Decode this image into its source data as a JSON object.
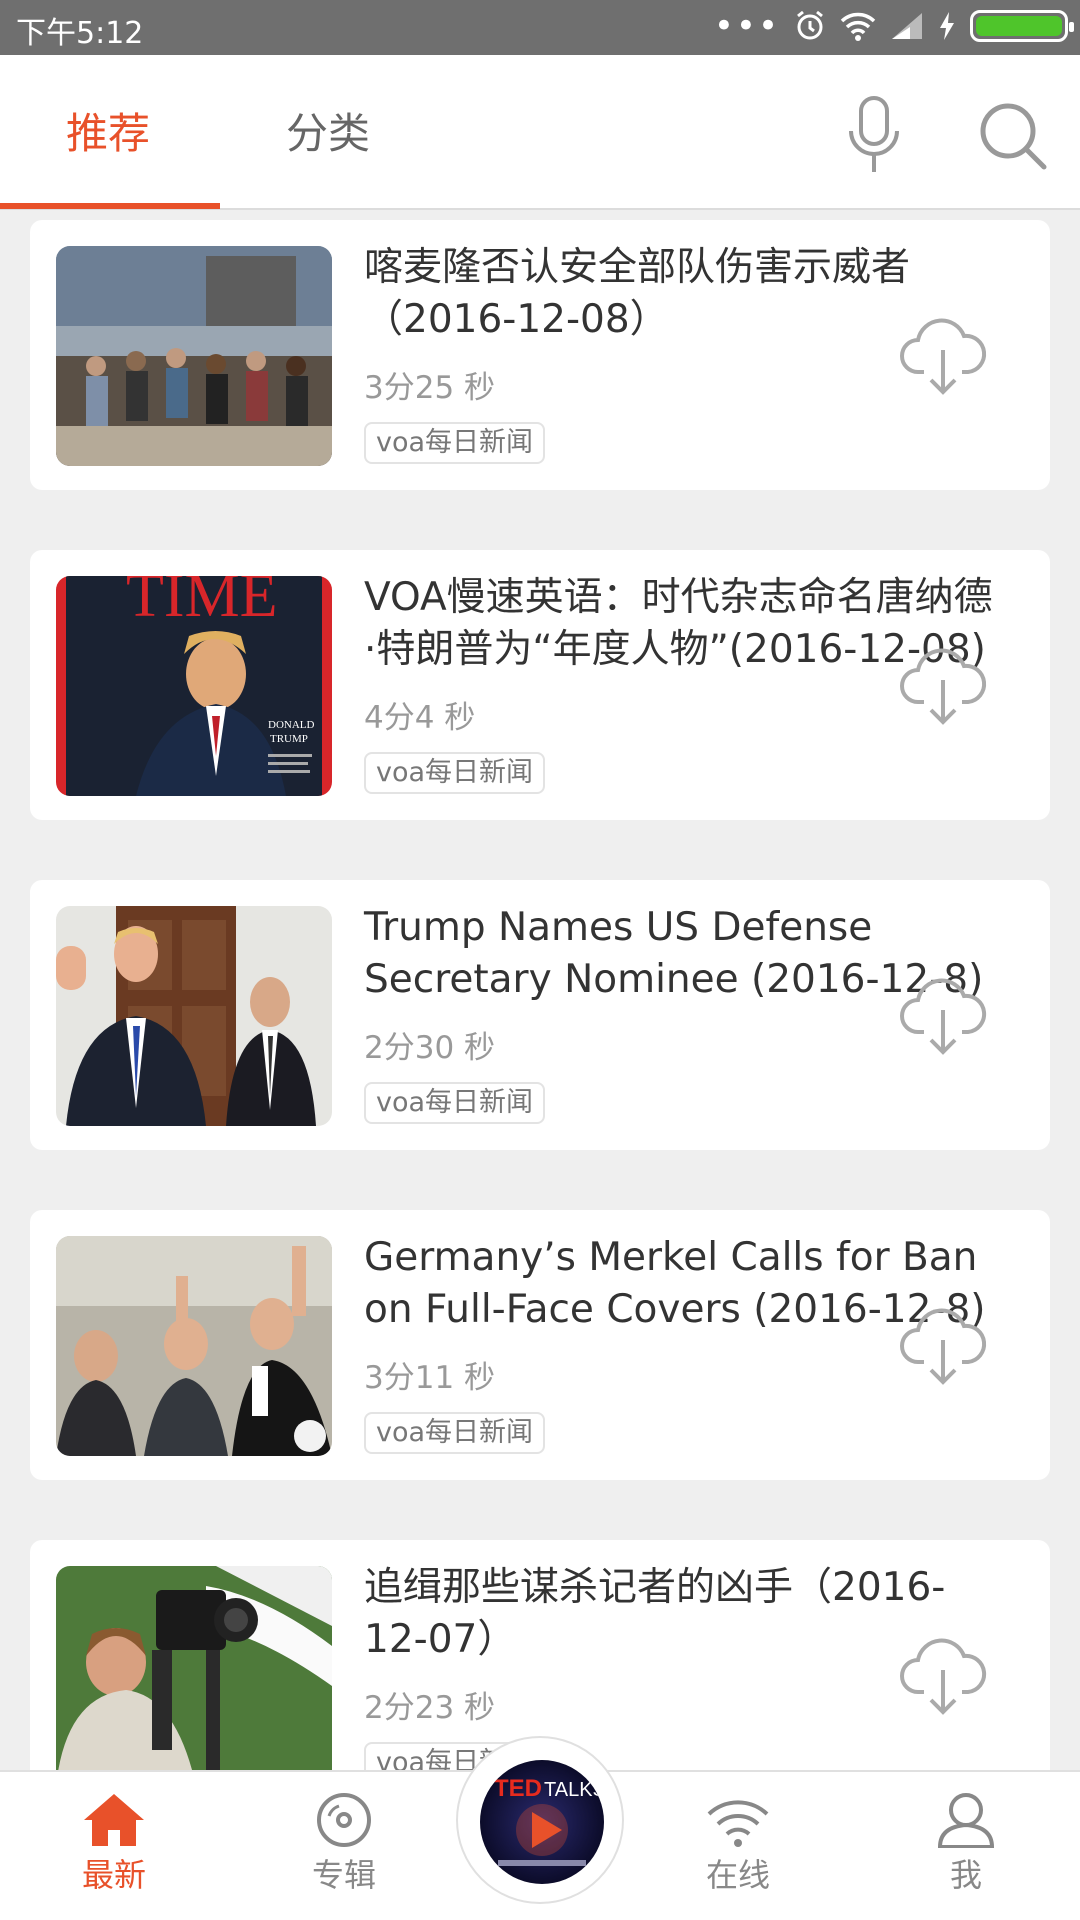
{
  "status_bar": {
    "time": "下午5:12",
    "dots": "•••"
  },
  "tabs": {
    "recommend": "推荐",
    "category": "分类"
  },
  "articles": [
    {
      "title": "喀麦隆否认安全部队伤害示威者（2016-12-08）",
      "duration": "3分25 秒",
      "tag": "voa每日新闻"
    },
    {
      "title": "VOA慢速英语：时代杂志命名唐纳德·特朗普为“年度人物”(2016-12-08)",
      "duration": "4分4 秒",
      "tag": "voa每日新闻"
    },
    {
      "title": "Trump Names US Defense Secretary Nominee (2016-12-8)",
      "duration": "2分30 秒",
      "tag": "voa每日新闻"
    },
    {
      "title": "Germany’s Merkel Calls for Ban on Full-Face Covers (2016-12-8)",
      "duration": "3分11 秒",
      "tag": "voa每日新闻"
    },
    {
      "title": "追缉那些谋杀记者的凶手（2016-12-07）",
      "duration": "2分23 秒",
      "tag": "voa每日新闻"
    }
  ],
  "thumbnail_texts": {
    "time_logo": "TIME",
    "donald": "DONALD",
    "trump": "TRUMP",
    "ted": "TED",
    "talks": "TALKS"
  },
  "bottom_nav": {
    "latest": "最新",
    "album": "专辑",
    "online": "在线",
    "me": "我"
  },
  "colors": {
    "accent": "#e8512a",
    "battery": "#4fc52b"
  }
}
